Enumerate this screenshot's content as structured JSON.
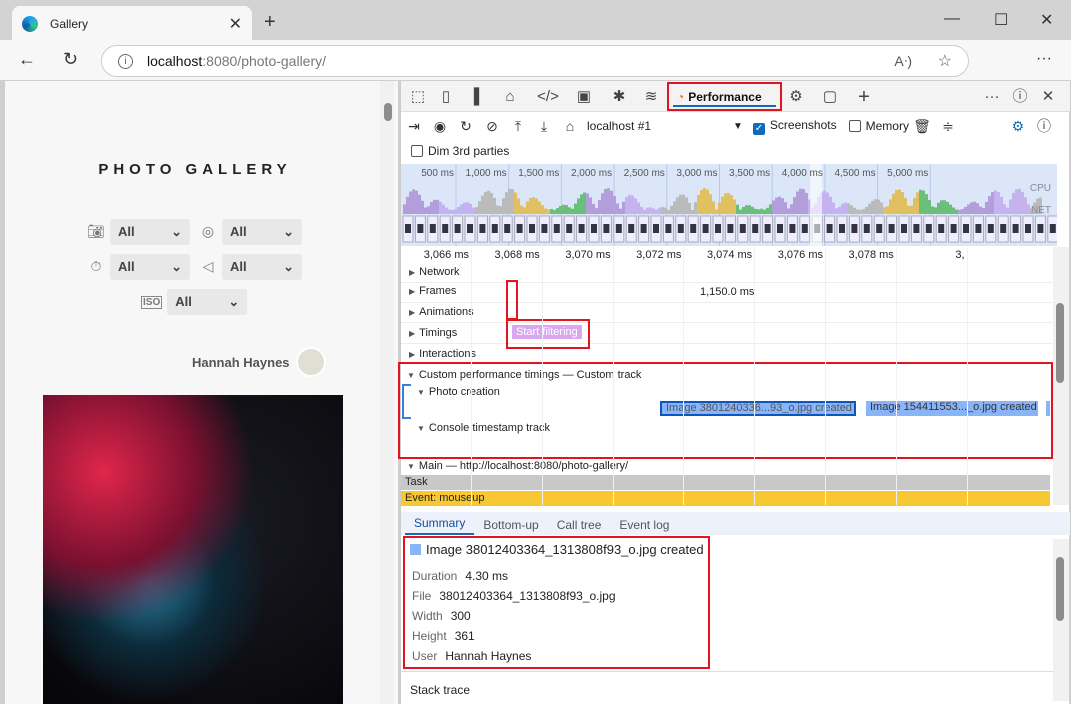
{
  "browser": {
    "tab_title": "Gallery",
    "url_host": "localhost",
    "url_rest": ":8080/photo-gallery/"
  },
  "page": {
    "title": "PHOTO GALLERY",
    "filters": [
      {
        "icon": "camera-icon",
        "value": "All"
      },
      {
        "icon": "aperture-icon",
        "value": "All"
      },
      {
        "icon": "timer-icon",
        "value": "All"
      },
      {
        "icon": "focal-length-icon",
        "value": "All"
      },
      {
        "icon": "iso-icon",
        "value": "All",
        "icon_text": "ISO"
      }
    ],
    "user": "Hannah Haynes"
  },
  "devtools": {
    "active_tab": "Performance",
    "target": "localhost #1",
    "screenshots_label": "Screenshots",
    "screenshots_checked": true,
    "memory_label": "Memory",
    "memory_checked": false,
    "dim_label": "Dim 3rd parties",
    "dim_checked": false,
    "overview_ticks": [
      "500 ms",
      "1,000 ms",
      "1,500 ms",
      "2,000 ms",
      "2,500 ms",
      "3,000 ms",
      "3,500 ms",
      "4,000 ms",
      "4,500 ms",
      "5,000 ms"
    ],
    "overview_labels": {
      "cpu": "CPU",
      "net": "NET"
    },
    "ruler_ticks": [
      "3,066 ms",
      "3,068 ms",
      "3,070 ms",
      "3,072 ms",
      "3,074 ms",
      "3,076 ms",
      "3,078 ms",
      "3,"
    ],
    "tracks": {
      "network": "Network",
      "frames": "Frames",
      "frames_value": "1,150.0 ms",
      "animations": "Animations",
      "timings": "Timings",
      "timing_marker": "Start filtering",
      "interactions": "Interactions",
      "custom": "Custom performance timings — Custom track",
      "photo_creation": "Photo creation",
      "console": "Console timestamp track",
      "main": "Main — http://localhost:8080/photo-gallery/",
      "task": "Task",
      "event": "Event: mouseup"
    },
    "events": [
      "Image 3801240336...93_o.jpg created",
      "Image 154411553..._o.jpg created"
    ],
    "bottom_tabs": [
      "Summary",
      "Bottom-up",
      "Call tree",
      "Event log"
    ],
    "summary": {
      "title": "Image 38012403364_1313808f93_o.jpg created",
      "rows": [
        {
          "k": "Duration",
          "v": "4.30 ms"
        },
        {
          "k": "File",
          "v": "38012403364_1313808f93_o.jpg"
        },
        {
          "k": "Width",
          "v": "300"
        },
        {
          "k": "Height",
          "v": "361"
        },
        {
          "k": "User",
          "v": "Hannah Haynes"
        }
      ],
      "stack_trace": "Stack trace"
    },
    "colors": {
      "highlight": "#e0151f",
      "accent": "#0f6cbd",
      "event": "#8ab4f8",
      "task": "#c8c8c8",
      "mouseup": "#f8c832",
      "timing": "#d8a8f0"
    }
  }
}
